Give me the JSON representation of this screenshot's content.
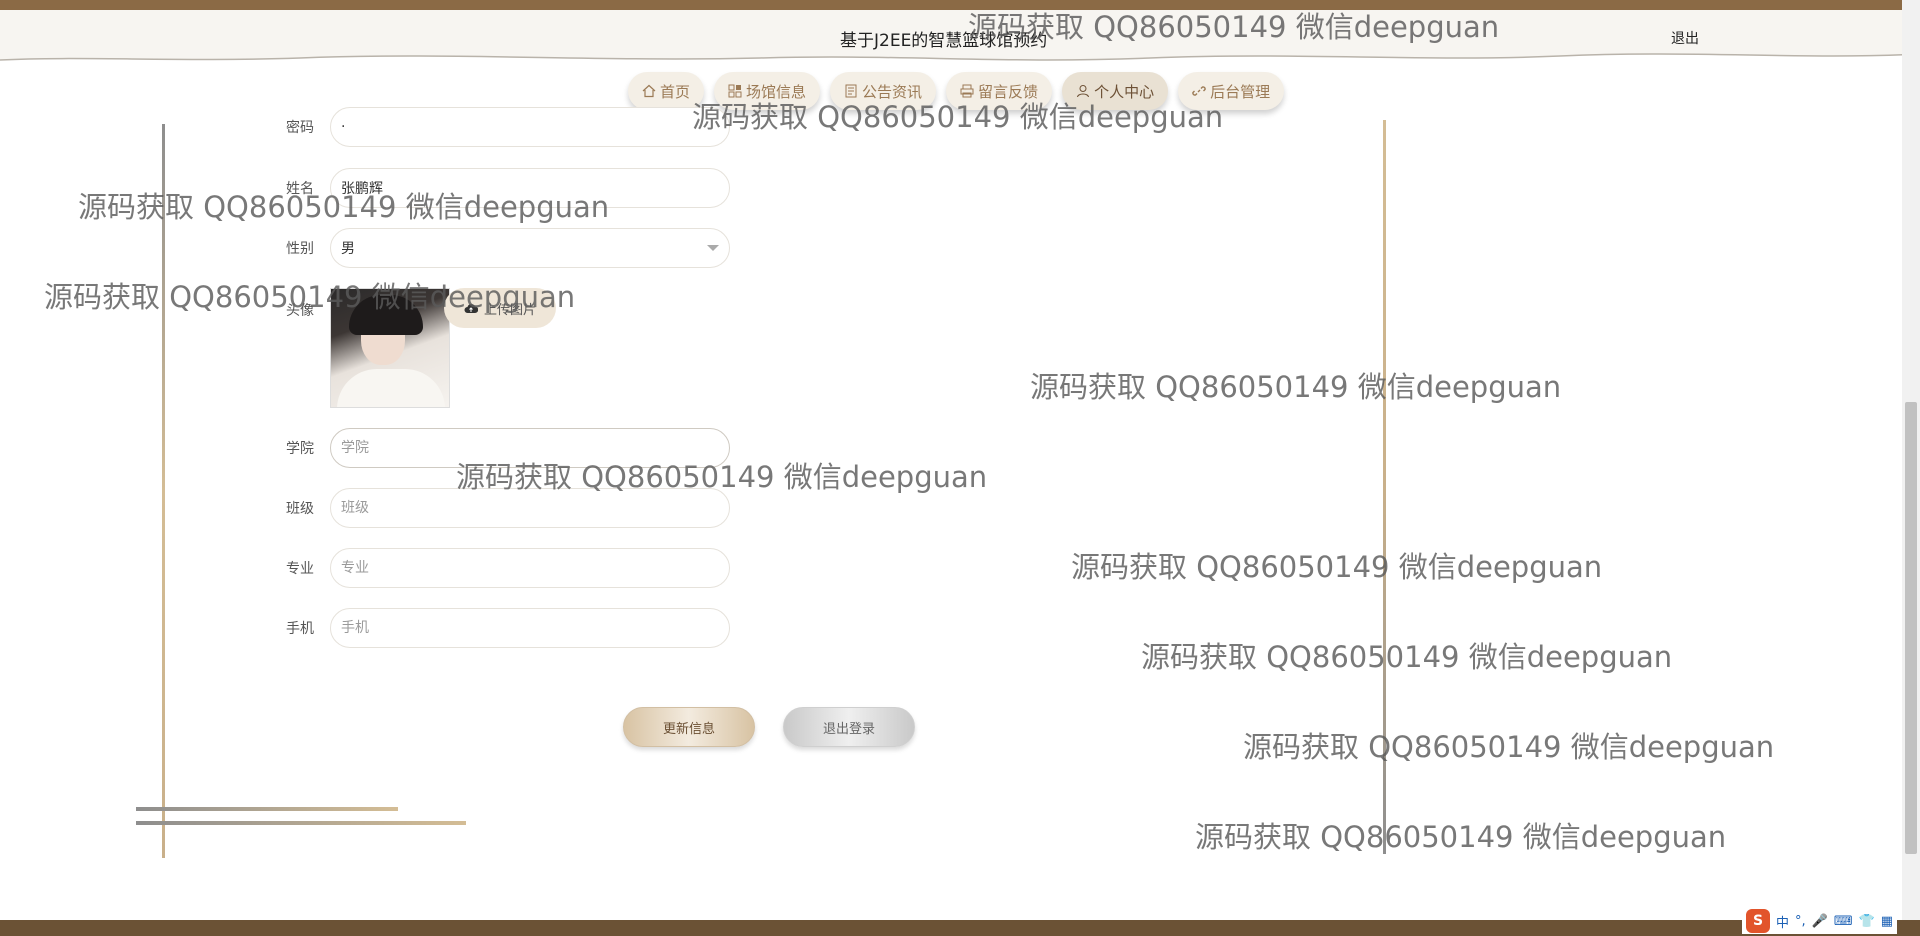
{
  "header": {
    "title": "基于J2EE的智慧篮球馆预约",
    "logout": "退出"
  },
  "nav": [
    {
      "label": "首页",
      "icon": "home-icon"
    },
    {
      "label": "场馆信息",
      "icon": "grid-icon"
    },
    {
      "label": "公告资讯",
      "icon": "document-icon"
    },
    {
      "label": "留言反馈",
      "icon": "printer-icon"
    },
    {
      "label": "个人中心",
      "icon": "user-icon",
      "active": true
    },
    {
      "label": "后台管理",
      "icon": "link-icon"
    }
  ],
  "form": {
    "password": {
      "label": "密码",
      "value": "·"
    },
    "name": {
      "label": "姓名",
      "value": "张鹏辉"
    },
    "gender": {
      "label": "性别",
      "value": "男"
    },
    "avatar": {
      "label": "头像",
      "upload": "上传图片"
    },
    "college": {
      "label": "学院",
      "placeholder": "学院"
    },
    "class": {
      "label": "班级",
      "placeholder": "班级"
    },
    "major": {
      "label": "专业",
      "placeholder": "专业"
    },
    "phone": {
      "label": "手机",
      "placeholder": "手机"
    }
  },
  "actions": {
    "update": "更新信息",
    "logout": "退出登录"
  },
  "watermark": "源码获取 QQ86050149 微信deepguan",
  "ime": {
    "logo": "S",
    "lang": "中"
  },
  "colors": {
    "brand_brown": "#8b6a45",
    "nav_text": "#9b7a55",
    "accent_gold": "#c9b08a"
  }
}
